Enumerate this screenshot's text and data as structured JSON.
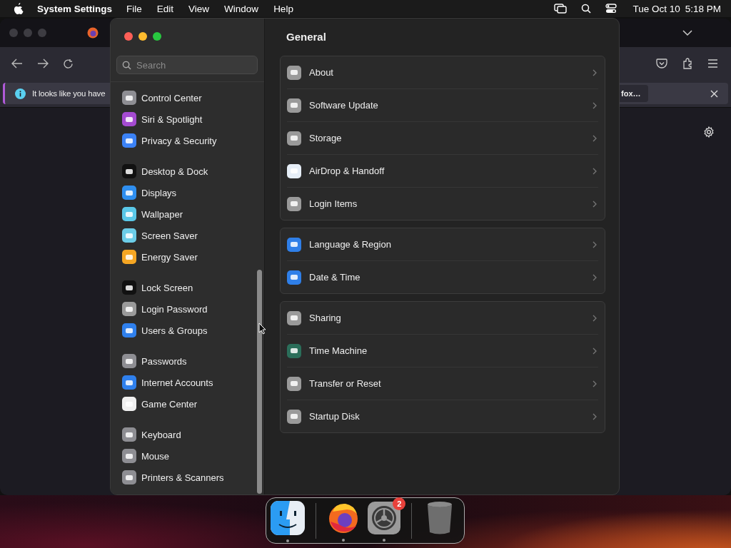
{
  "menubar": {
    "app_name": "System Settings",
    "menus": [
      "File",
      "Edit",
      "View",
      "Window",
      "Help"
    ],
    "date": "Tue Oct 10",
    "time": "5:18 PM"
  },
  "browser": {
    "notification": "It looks like you have",
    "notification_button": "fox…"
  },
  "settings": {
    "search": {
      "placeholder": "Search"
    },
    "sidebar_groups": [
      {
        "items": [
          {
            "label": "Control Center",
            "color": "#8e8e93"
          },
          {
            "label": "Siri & Spotlight",
            "color": "#a54bd1"
          },
          {
            "label": "Privacy & Security",
            "color": "#3b82f6"
          }
        ]
      },
      {
        "items": [
          {
            "label": "Desktop & Dock",
            "color": "#111111"
          },
          {
            "label": "Displays",
            "color": "#2f8ff0"
          },
          {
            "label": "Wallpaper",
            "color": "#5ac8e8"
          },
          {
            "label": "Screen Saver",
            "color": "#6ccde8"
          },
          {
            "label": "Energy Saver",
            "color": "#f5a623"
          }
        ]
      },
      {
        "items": [
          {
            "label": "Lock Screen",
            "color": "#111111"
          },
          {
            "label": "Login Password",
            "color": "#9a9a9a"
          },
          {
            "label": "Users & Groups",
            "color": "#2f80ed"
          }
        ]
      },
      {
        "items": [
          {
            "label": "Passwords",
            "color": "#8e8e93"
          },
          {
            "label": "Internet Accounts",
            "color": "#2f80ed"
          },
          {
            "label": "Game Center",
            "color": "#f0f0f0"
          }
        ]
      },
      {
        "items": [
          {
            "label": "Keyboard",
            "color": "#8e8e93"
          },
          {
            "label": "Mouse",
            "color": "#8e8e93"
          },
          {
            "label": "Printers & Scanners",
            "color": "#8e8e93"
          }
        ]
      }
    ],
    "title": "General",
    "groups": [
      {
        "rows": [
          {
            "label": "About",
            "color": "#9a9a9a"
          },
          {
            "label": "Software Update",
            "color": "#9a9a9a"
          },
          {
            "label": "Storage",
            "color": "#9a9a9a"
          },
          {
            "label": "AirDrop & Handoff",
            "color": "#e6eef7"
          },
          {
            "label": "Login Items",
            "color": "#9a9a9a"
          }
        ]
      },
      {
        "rows": [
          {
            "label": "Language & Region",
            "color": "#2f7fe8"
          },
          {
            "label": "Date & Time",
            "color": "#2f7fe8"
          }
        ]
      },
      {
        "rows": [
          {
            "label": "Sharing",
            "color": "#9a9a9a"
          },
          {
            "label": "Time Machine",
            "color": "#2b6e5a"
          },
          {
            "label": "Transfer or Reset",
            "color": "#9a9a9a"
          },
          {
            "label": "Startup Disk",
            "color": "#9a9a9a"
          }
        ]
      }
    ]
  },
  "dock": {
    "items": [
      {
        "kind": "finder",
        "running": true
      },
      {
        "kind": "separator"
      },
      {
        "kind": "firefox",
        "running": true
      },
      {
        "kind": "settings",
        "running": true,
        "badge": "2"
      },
      {
        "kind": "separator"
      },
      {
        "kind": "trash",
        "running": false
      }
    ]
  }
}
